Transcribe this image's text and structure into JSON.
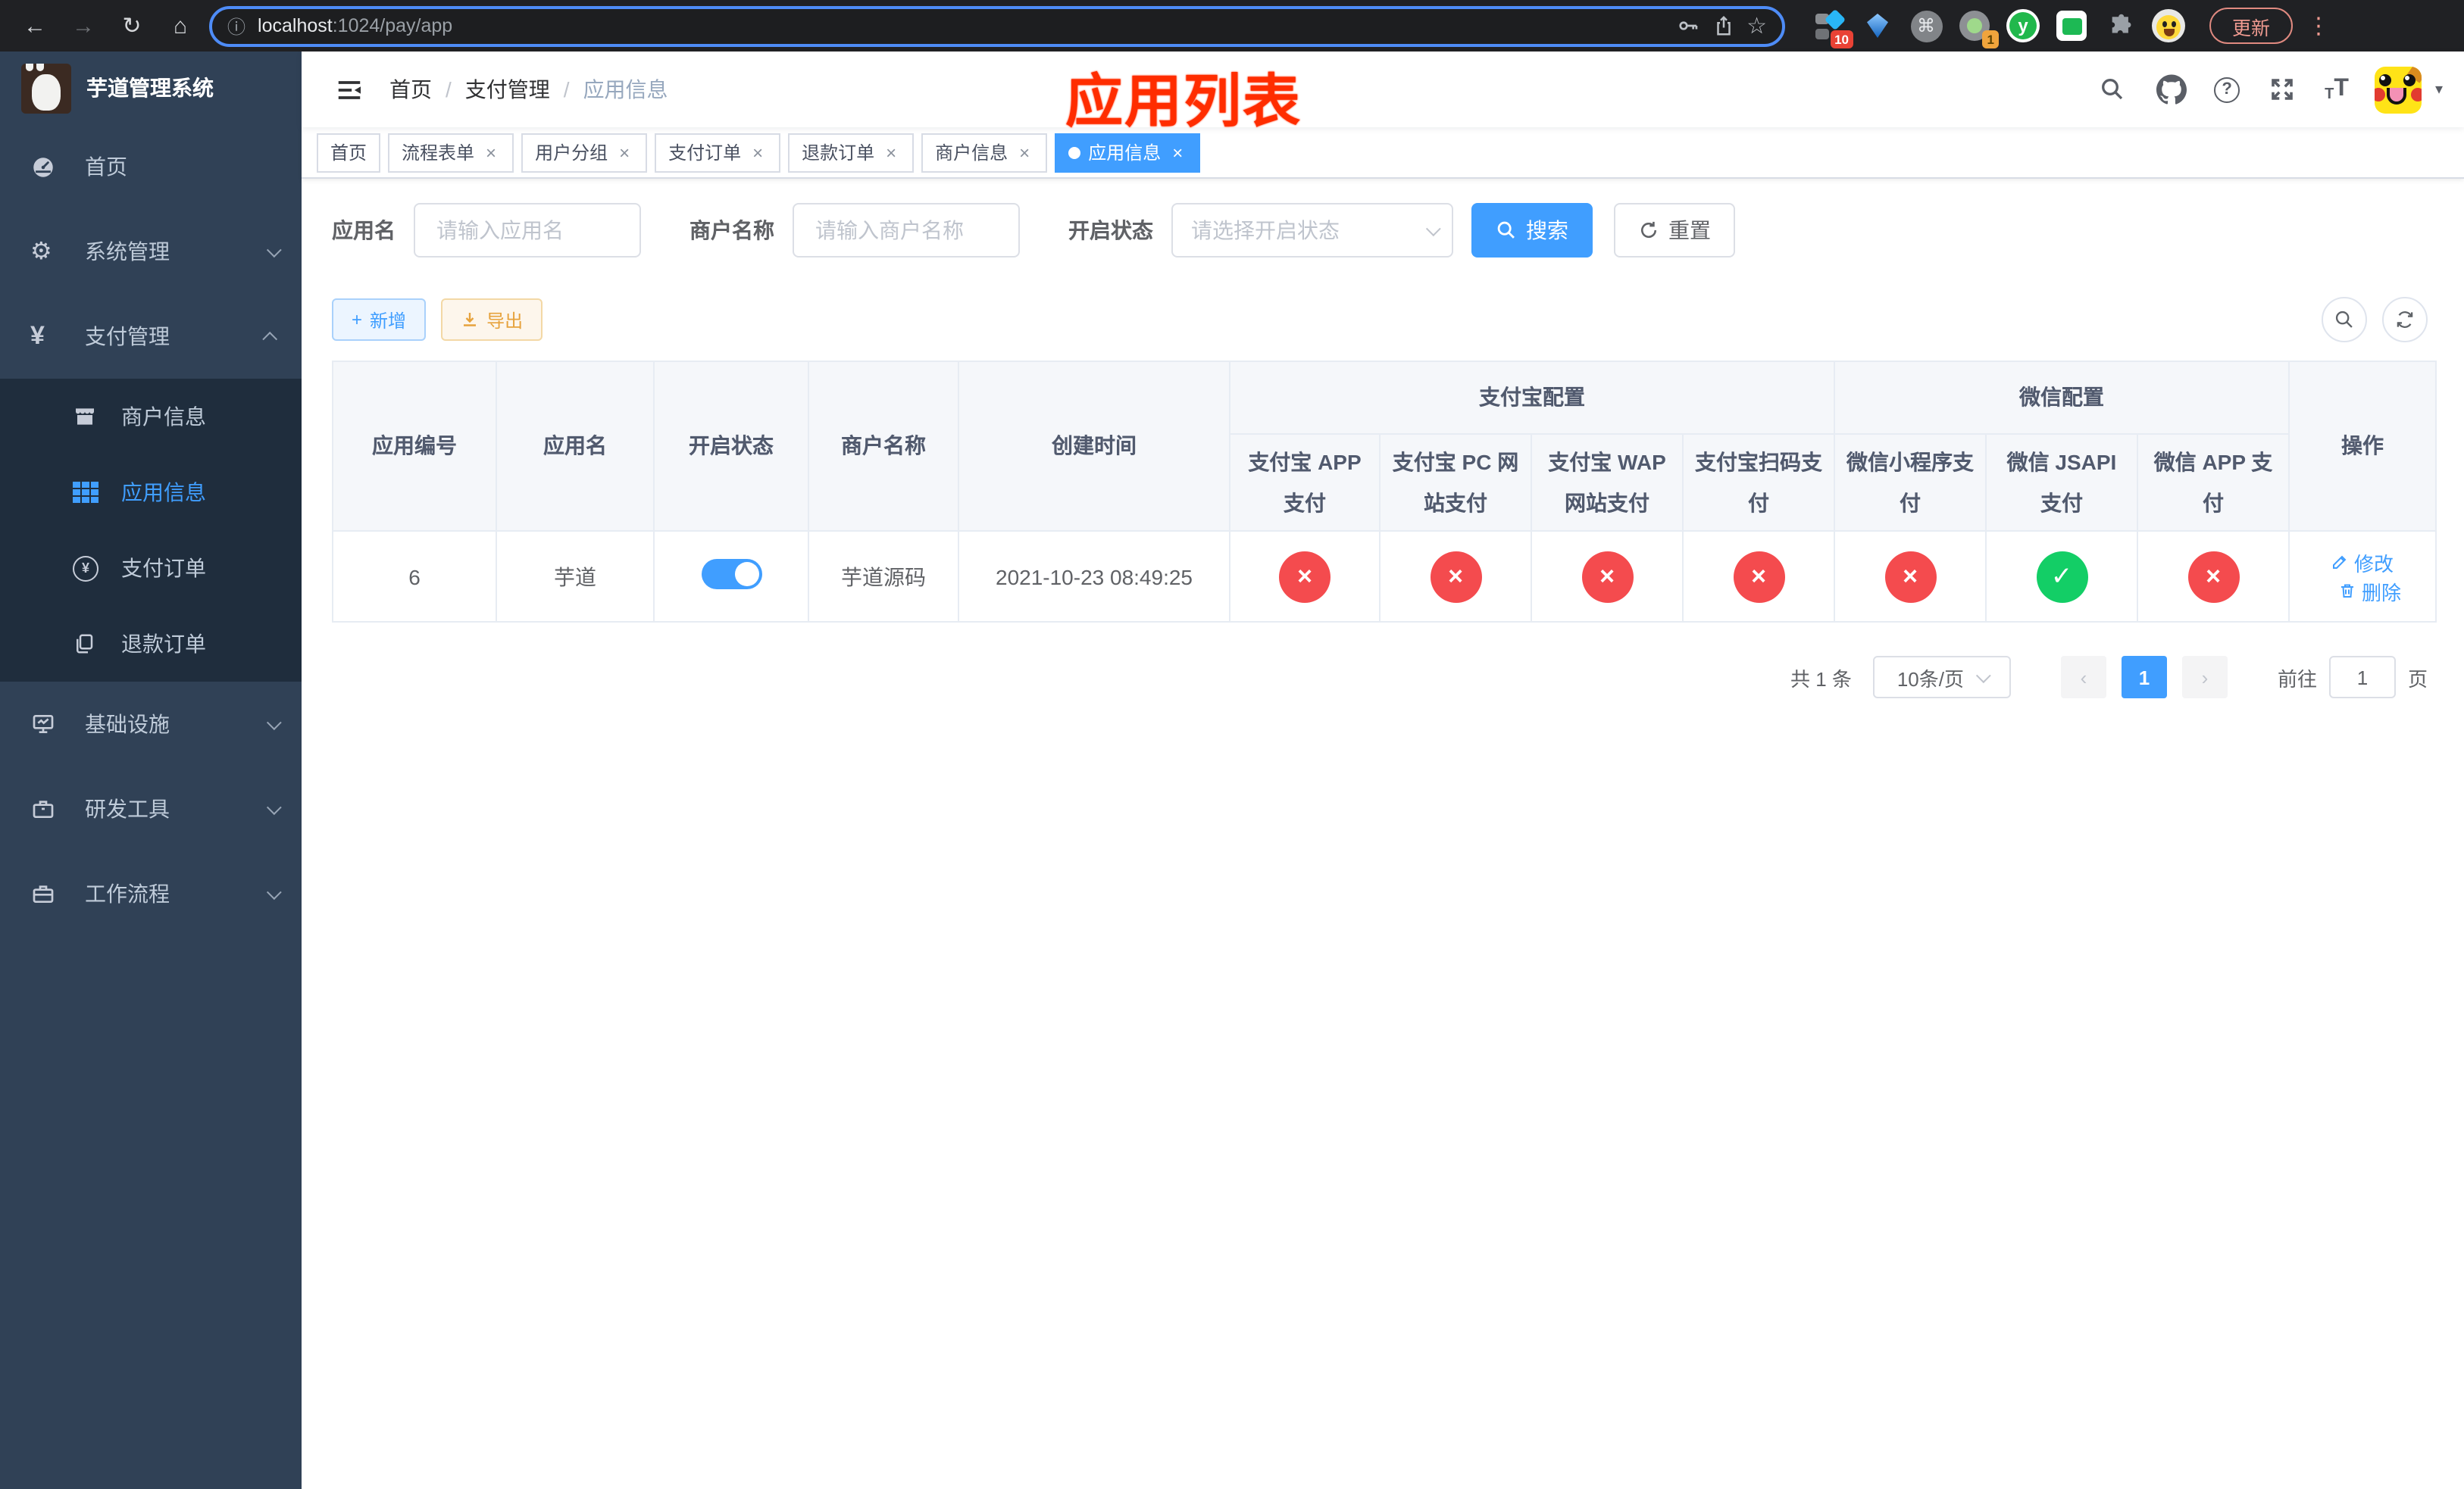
{
  "colors": {
    "accent": "#409eff",
    "sidebar_bg": "#304156",
    "submenu_bg": "#1f2d3d",
    "fail_red": "#f44b4e",
    "success_green": "#13ce66",
    "annotation_red": "#ff2d00",
    "export_orange": "#e6a23c"
  },
  "icons": {
    "back": "←",
    "forward": "→",
    "reload": "↻",
    "home": "⌂",
    "info": "ⓘ",
    "star": "☆",
    "cmd": "⌘",
    "dots_v": "⋮",
    "y_letter": "y",
    "close": "×",
    "check": "✓",
    "cross": "×",
    "sep": "/",
    "gear": "⚙",
    "yen": "¥",
    "question": "?",
    "plus": "+",
    "t_small": "T",
    "t_big": "T",
    "caret": "▾",
    "prev": "‹",
    "next": "›"
  },
  "browser": {
    "url_host": "localhost",
    "url_path": ":1024/pay/app",
    "ext_badge_1": "10",
    "ext_badge_2": "1",
    "update_label": "更新"
  },
  "sidebar": {
    "title": "芋道管理系统",
    "items": [
      {
        "label": "首页",
        "icon": "dashboard-icon"
      },
      {
        "label": "系统管理",
        "icon": "gear-icon",
        "expanded": false
      },
      {
        "label": "支付管理",
        "icon": "yen-icon",
        "expanded": true,
        "children": [
          {
            "label": "商户信息",
            "icon": "shop-icon",
            "active": false
          },
          {
            "label": "应用信息",
            "icon": "grid-icon",
            "active": true
          },
          {
            "label": "支付订单",
            "icon": "pay-order-icon",
            "active": false
          },
          {
            "label": "退款订单",
            "icon": "refund-icon",
            "active": false
          }
        ]
      },
      {
        "label": "基础设施",
        "icon": "monitor-icon",
        "expanded": false
      },
      {
        "label": "研发工具",
        "icon": "toolbox-icon",
        "expanded": false
      },
      {
        "label": "工作流程",
        "icon": "briefcase-icon",
        "expanded": false
      }
    ]
  },
  "navbar": {
    "breadcrumb": [
      "首页",
      "支付管理",
      "应用信息"
    ]
  },
  "annotation": "应用列表",
  "tabs": [
    {
      "label": "首页",
      "closable": false,
      "active": false
    },
    {
      "label": "流程表单",
      "closable": true,
      "active": false
    },
    {
      "label": "用户分组",
      "closable": true,
      "active": false
    },
    {
      "label": "支付订单",
      "closable": true,
      "active": false
    },
    {
      "label": "退款订单",
      "closable": true,
      "active": false
    },
    {
      "label": "商户信息",
      "closable": true,
      "active": false
    },
    {
      "label": "应用信息",
      "closable": true,
      "active": true
    }
  ],
  "filters": {
    "app_name_label": "应用名",
    "app_name_placeholder": "请输入应用名",
    "merchant_label": "商户名称",
    "merchant_placeholder": "请输入商户名称",
    "status_label": "开启状态",
    "status_placeholder": "请选择开启状态",
    "search_label": "搜索",
    "reset_label": "重置"
  },
  "toolbar": {
    "add_label": "新增",
    "export_label": "导出"
  },
  "table": {
    "groups": {
      "alipay": "支付宝配置",
      "wechat": "微信配置"
    },
    "columns": [
      "应用编号",
      "应用名",
      "开启状态",
      "商户名称",
      "创建时间",
      "支付宝 APP 支付",
      "支付宝 PC 网站支付",
      "支付宝 WAP 网站支付",
      "支付宝扫码支付",
      "微信小程序支付",
      "微信 JSAPI 支付",
      "微信 APP 支付",
      "操作"
    ],
    "row": {
      "id": "6",
      "name": "芋道",
      "enabled": true,
      "merchant": "芋道源码",
      "created": "2021-10-23 08:49:25",
      "statuses": [
        "fail",
        "fail",
        "fail",
        "fail",
        "fail",
        "success",
        "fail"
      ],
      "edit_label": "修改",
      "delete_label": "删除"
    }
  },
  "pagination": {
    "total": "共 1 条",
    "page_size": "10条/页",
    "current": "1",
    "goto_label": "前往",
    "goto_value": "1",
    "page_unit": "页"
  }
}
